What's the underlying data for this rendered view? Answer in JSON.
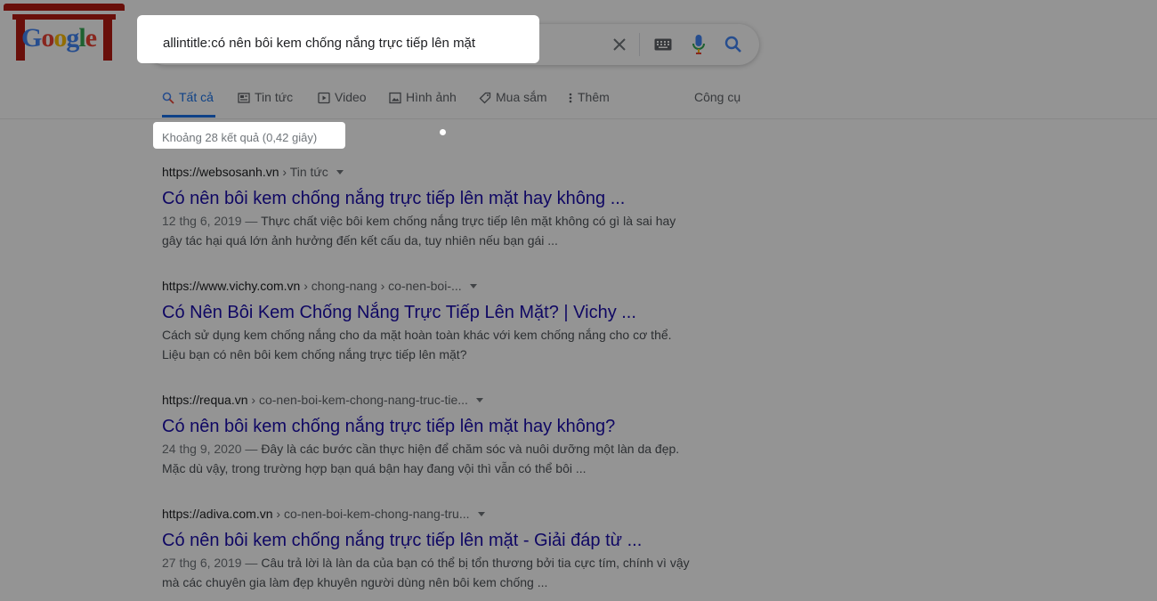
{
  "logo": {
    "letters": [
      "G",
      "o",
      "o",
      "g",
      "l",
      "e"
    ],
    "colors": [
      "#4285f4",
      "#ea4335",
      "#fbbc05",
      "#4285f4",
      "#34a853",
      "#ea4335"
    ]
  },
  "search": {
    "query": "allintitle:có nên bôi kem chống nắng trực tiếp lên mặt"
  },
  "tabs": [
    {
      "label": "Tất cả",
      "icon": "search-icon",
      "active": true
    },
    {
      "label": "Tin tức",
      "icon": "news-icon"
    },
    {
      "label": "Video",
      "icon": "video-icon"
    },
    {
      "label": "Hình ảnh",
      "icon": "image-icon"
    },
    {
      "label": "Mua sắm",
      "icon": "tag-icon"
    },
    {
      "label": "Thêm",
      "icon": "more-vert-icon"
    }
  ],
  "tools_label": "Công cụ",
  "stats": "Khoảng 28 kết quả (0,42 giây)",
  "results": [
    {
      "site": "https://websosanh.vn",
      "path": " › Tin tức",
      "title": "Có nên bôi kem chống nắng trực tiếp lên mặt hay không ...",
      "date": "12 thg 6, 2019 — ",
      "snippet": "Thực chất việc bôi kem chống nắng trực tiếp lên mặt không có gì là sai hay gây tác hại quá lớn ảnh hưởng đến kết cấu da, tuy nhiên nếu bạn gái ..."
    },
    {
      "site": "https://www.vichy.com.vn",
      "path": " › chong-nang › co-nen-boi-...",
      "title": "Có Nên Bôi Kem Chống Nắng Trực Tiếp Lên Mặt? | Vichy ...",
      "date": "",
      "snippet": "Cách sử dụng kem chống nắng cho da mặt hoàn toàn khác với kem chống nắng cho cơ thể. Liệu bạn có nên bôi kem chống nắng trực tiếp lên mặt?"
    },
    {
      "site": "https://requa.vn",
      "path": " › co-nen-boi-kem-chong-nang-truc-tie...",
      "title": "Có nên bôi kem chống nắng trực tiếp lên mặt hay không?",
      "date": "24 thg 9, 2020 — ",
      "snippet": "Đây là các bước cần thực hiện để chăm sóc và nuôi dưỡng một làn da đẹp. Mặc dù vậy, trong trường hợp bạn quá bận hay đang vội thì vẫn có thể bôi ..."
    },
    {
      "site": "https://adiva.com.vn",
      "path": " › co-nen-boi-kem-chong-nang-tru...",
      "title": "Có nên bôi kem chống nắng trực tiếp lên mặt - Giải đáp từ ...",
      "date": "27 thg 6, 2019 — ",
      "snippet": "Câu trả lời là làn da của bạn có thể bị tổn thương bởi tia cực tím, chính vì vậy mà các chuyên gia làm đẹp khuyên người dùng nên bôi kem chống ..."
    }
  ],
  "colors": {
    "link": "#1a0dab",
    "accent": "#1a73e8",
    "overlay": "rgba(0,0,0,0.42)"
  }
}
